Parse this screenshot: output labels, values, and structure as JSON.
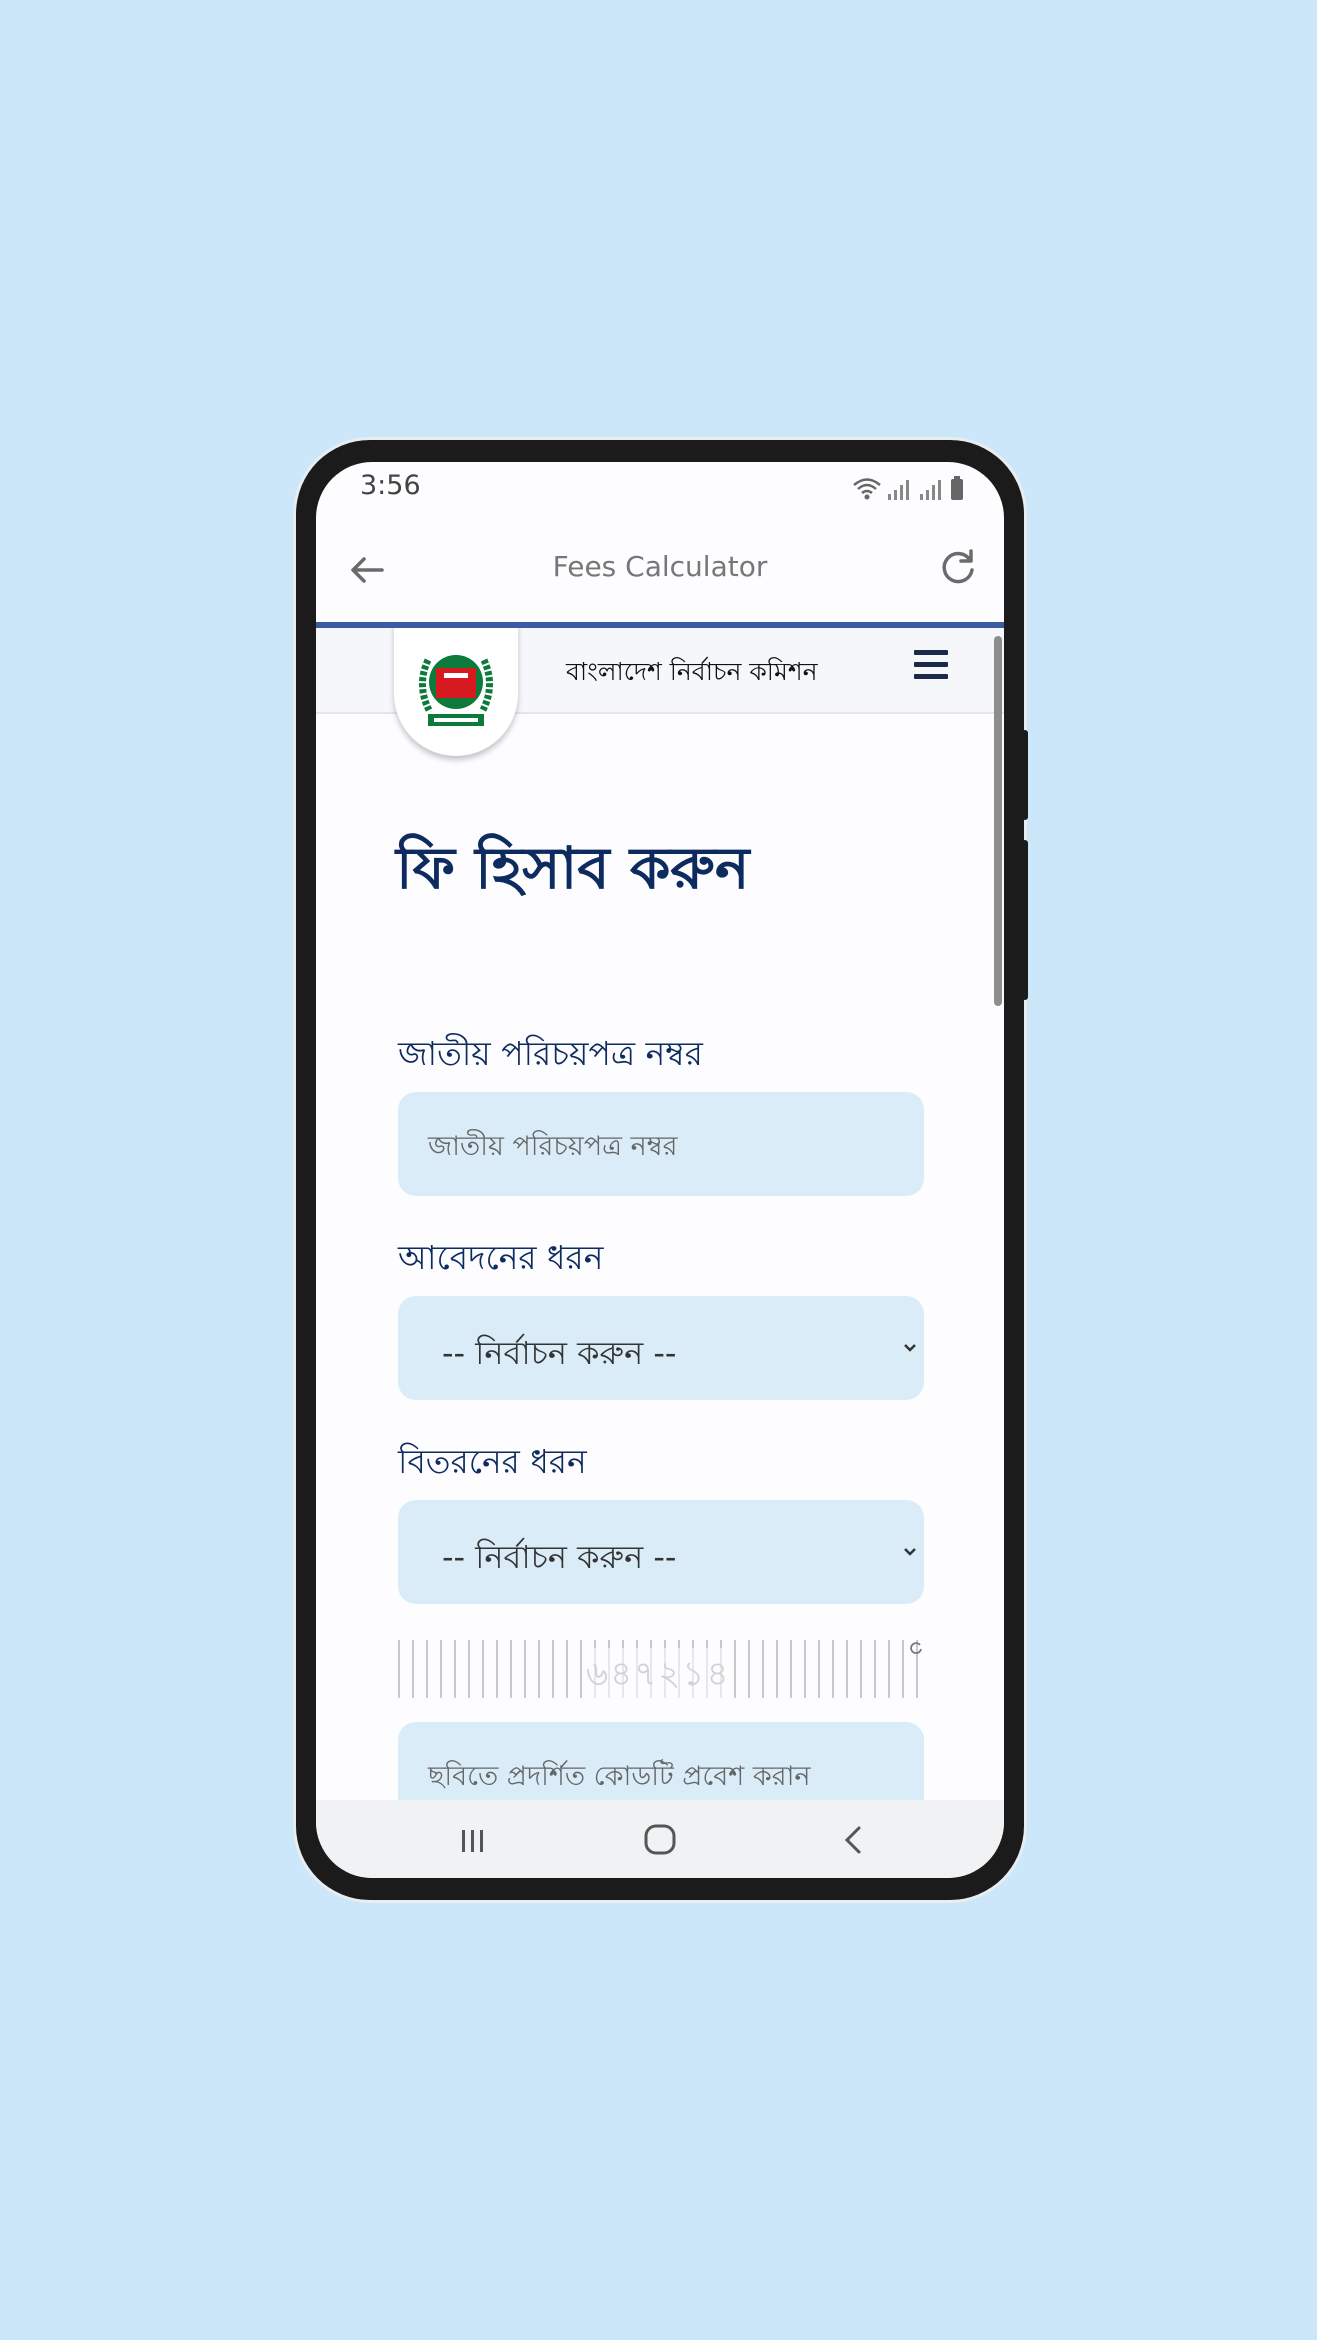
{
  "status_bar": {
    "time": "3:56"
  },
  "app_bar": {
    "title": "Fees Calculator"
  },
  "site": {
    "name": "বাংলাদেশ নির্বাচন কমিশন"
  },
  "page": {
    "title": "ফি হিসাব করুন"
  },
  "form": {
    "nid": {
      "label": "জাতীয় পরিচয়পত্র নম্বর",
      "placeholder": "জাতীয় পরিচয়পত্র নম্বর",
      "value": ""
    },
    "application_type": {
      "label": "আবেদনের ধরন",
      "selected": "-- নির্বাচন করুন --"
    },
    "delivery_type": {
      "label": "বিতরনের ধরন",
      "selected": "-- নির্বাচন করুন --"
    },
    "captcha": {
      "code": "৬৪৭২১৪",
      "placeholder": "ছবিতে প্রদর্শিত কোডটি প্রবেশ করান"
    }
  },
  "colors": {
    "background": "#cbe7f9",
    "accent_line": "#3d5aa6",
    "heading": "#0d2b5e",
    "field_bg": "#d9ecf8",
    "logo_red": "#d71920",
    "logo_green": "#0b7a3b"
  },
  "icons": [
    "back-arrow-icon",
    "reload-icon",
    "wifi-icon",
    "signal-icon",
    "battery-icon",
    "menu-icon",
    "chevron-down-icon",
    "refresh-icon",
    "recent-apps-icon",
    "home-icon",
    "nav-back-icon"
  ]
}
